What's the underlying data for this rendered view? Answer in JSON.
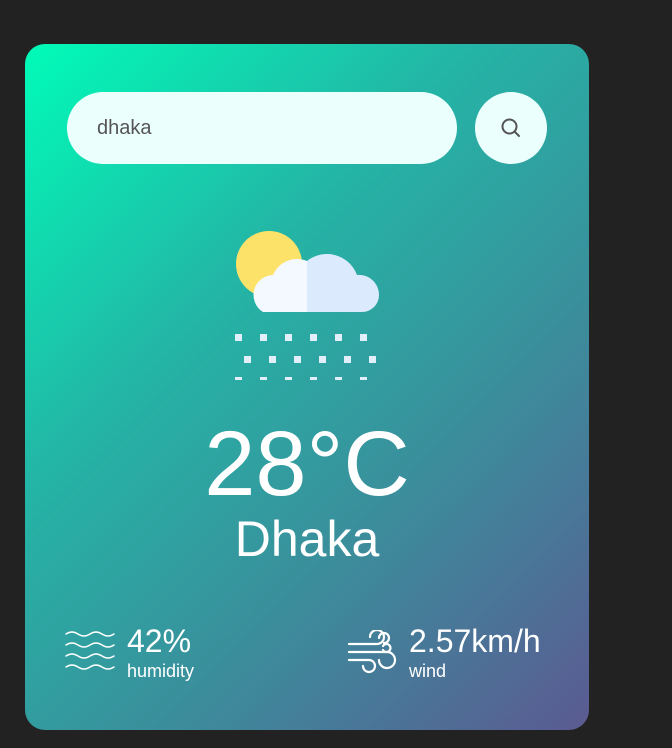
{
  "search": {
    "value": "dhaka"
  },
  "weather": {
    "temperature": "28°C",
    "city": "Dhaka",
    "icon": "sun-cloud-snow-icon"
  },
  "details": {
    "humidity": {
      "value": "42%",
      "label": "humidity",
      "icon": "humidity-waves-icon"
    },
    "wind": {
      "value": "2.57km/h",
      "label": "wind",
      "icon": "wind-icon"
    }
  },
  "colors": {
    "background": "#222222",
    "gradient_start": "#00fcb8",
    "gradient_end": "#5b5a92",
    "input_bg": "#ebfffc",
    "text": "#ffffff"
  }
}
